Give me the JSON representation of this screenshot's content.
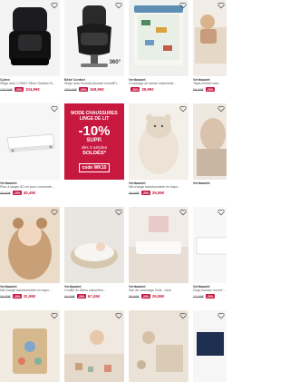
{
  "products": [
    {
      "brand": "Cybex",
      "title": "Siège auto CYBEX Silver Solution B...",
      "old_price": "129,99€",
      "discount": "-20%",
      "price": "104,99€"
    },
    {
      "brand": "Bébé Confort",
      "title": "Siège auto évolutif pivotant evolutiFi...",
      "old_price": "209,99€",
      "discount": "-20%",
      "price": "169,99€",
      "badge": "360°"
    },
    {
      "brand": "Vertbaudet",
      "title": "Couchage de sieste maternelle...",
      "old_price": "",
      "discount": "-20%",
      "price": "39,99€"
    },
    {
      "brand": "Vertbaudet",
      "title": "Tapis d'éveil maxi...",
      "old_price": "59,99€",
      "discount": "-20%",
      "price": ""
    },
    {
      "brand": "Vertbaudet",
      "title": "Plan à langer 52 cm pour commode...",
      "old_price": "49,99€",
      "discount": "-20%",
      "price": "40,49€"
    },
    {
      "brand": "Vertbaudet",
      "title": "Nid d'ange transformable en bapo...",
      "old_price": "39,99€",
      "discount": "-25%",
      "price": "29,99€"
    },
    {
      "brand": "Vertbaudet",
      "title": "",
      "old_price": "",
      "discount": "",
      "price": ""
    },
    {
      "brand": "Vertbaudet",
      "title": "Nid d'ange transformable en bapo...",
      "old_price": "39,99€",
      "discount": "-20%",
      "price": "31,99€"
    },
    {
      "brand": "Vertbaudet",
      "title": "Couffin en fibres naturelles...",
      "old_price": "84,99€",
      "discount": "-20%",
      "price": "67,49€"
    },
    {
      "brand": "Vertbaudet",
      "title": "Sac de couchage Chat - mixe",
      "old_price": "89,99€",
      "discount": "-20%",
      "price": "29,99€"
    },
    {
      "brand": "Vertbaudet",
      "title": "Drap-housse uni enfa...",
      "old_price": "12,99€",
      "discount": "-20%",
      "price": "10,39€"
    }
  ],
  "promo": {
    "line1": "MODE CHAUSSURES LINGE DE LIT",
    "big": "-10%",
    "line3": "SUPP.",
    "line4": "dès 3 articles",
    "line5": "SOLDÉS*",
    "code": "code WK10"
  },
  "colors": {
    "accent": "#c7183f"
  }
}
